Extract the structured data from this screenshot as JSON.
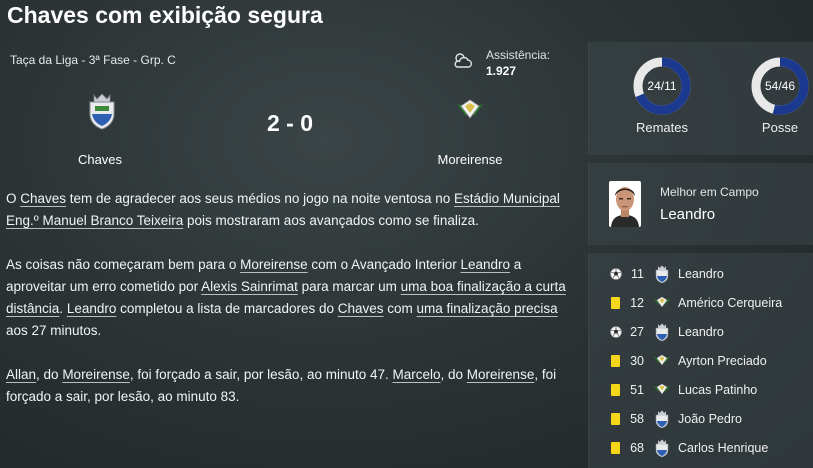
{
  "title": "Chaves com exibição segura",
  "match": {
    "competition": "Taça da Liga - 3ª Fase - Grp. C",
    "weather_icon": "partly-cloudy-icon",
    "attendance_label": "Assistência:",
    "attendance_value": "1.927",
    "home_team": "Chaves",
    "away_team": "Moreirense",
    "score": "2 - 0"
  },
  "report": {
    "p1": {
      "t0": "O ",
      "l0": "Chaves",
      "t1": " tem de agradecer aos seus médios no jogo na noite ventosa no ",
      "l1": "Estádio Municipal Eng.º Manuel Branco Teixeira",
      "t2": " pois mostraram aos avançados como se finaliza."
    },
    "p2": {
      "t0": "As coisas não começaram bem para o ",
      "l0": "Moreirense",
      "t1": " com o Avançado Interior ",
      "l1": "Leandro",
      "t2": " a aproveitar um erro cometido por ",
      "l2": "Alexis Sainrimat",
      "t3": " para marcar um ",
      "l3": "uma boa finalização a curta distância",
      "t4": ". ",
      "l4": "Leandro",
      "t5": " completou a lista de marcadores do ",
      "l5": "Chaves",
      "t6": " com ",
      "l6": "uma finalização precisa",
      "t7": " aos 27 minutos."
    },
    "p3": {
      "l0": "Allan",
      "t0": ", do ",
      "l1": "Moreirense",
      "t1": ", foi forçado a sair, por lesão, ao minuto 47. ",
      "l2": "Marcelo",
      "t2": ", do ",
      "l3": "Moreirense",
      "t3": ", foi forçado a sair, por lesão, ao minuto 83."
    }
  },
  "stats": {
    "shots": {
      "label": "Remates",
      "text": "24/11",
      "home": 24,
      "away": 11
    },
    "possession": {
      "label": "Posse",
      "text": "54/46",
      "home": 54,
      "away": 46
    }
  },
  "motm": {
    "label": "Melhor em Campo",
    "name": "Leandro"
  },
  "events": [
    {
      "minute": "11",
      "type": "goal",
      "team": "home",
      "player": "Leandro"
    },
    {
      "minute": "12",
      "type": "yellow-card",
      "team": "away",
      "player": "Américo Cerqueira"
    },
    {
      "minute": "27",
      "type": "goal",
      "team": "home",
      "player": "Leandro"
    },
    {
      "minute": "30",
      "type": "yellow-card",
      "team": "away",
      "player": "Ayrton Preciado"
    },
    {
      "minute": "51",
      "type": "yellow-card",
      "team": "away",
      "player": "Lucas Patinho"
    },
    {
      "minute": "58",
      "type": "yellow-card",
      "team": "home",
      "player": "João Pedro"
    },
    {
      "minute": "68",
      "type": "yellow-card",
      "team": "home",
      "player": "Carlos Henrique"
    }
  ],
  "colors": {
    "home_ring": "#1b3a8f",
    "away_ring": "#e8e8e8",
    "card": "#f5d619"
  }
}
